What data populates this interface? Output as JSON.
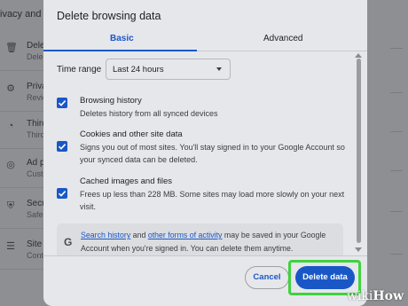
{
  "background": {
    "header_text": "ivacy and s",
    "rows": [
      {
        "icon": "trash-icon",
        "glyph": "🗑",
        "title": "Dele",
        "sub": "Dele"
      },
      {
        "icon": "privacy-guide-icon",
        "glyph": "⚙",
        "title": "Priva",
        "sub": "Revie"
      },
      {
        "icon": "cookie-icon",
        "glyph": "◔",
        "title": "Third",
        "sub": "Third"
      },
      {
        "icon": "ad-privacy-icon",
        "glyph": "◎",
        "title": "Ad p",
        "sub": "Custo"
      },
      {
        "icon": "security-icon",
        "glyph": "⛨",
        "title": "Secu",
        "sub": "Safe"
      },
      {
        "icon": "site-settings-icon",
        "glyph": "☰",
        "title": "Site s",
        "sub": "Contr"
      }
    ]
  },
  "dialog": {
    "title": "Delete browsing data",
    "tabs": [
      {
        "label": "Basic",
        "active": true
      },
      {
        "label": "Advanced",
        "active": false
      }
    ],
    "time_range": {
      "label": "Time range",
      "selected": "Last 24 hours"
    },
    "options": [
      {
        "title": "Browsing history",
        "desc": "Deletes history from all synced devices",
        "checked": true
      },
      {
        "title": "Cookies and other site data",
        "desc": "Signs you out of most sites. You'll stay signed in to your Google Account so your synced data can be deleted.",
        "checked": true
      },
      {
        "title": "Cached images and files",
        "desc": "Frees up less than 228 MB. Some sites may load more slowly on your next visit.",
        "checked": true
      }
    ],
    "info": {
      "icon_letter": "G",
      "link1": "Search history",
      "and": " and ",
      "link2": "other forms of activity",
      "rest": " may be saved in your Google Account when you're signed in. You can delete them anytime."
    },
    "buttons": {
      "cancel": "Cancel",
      "delete": "Delete data"
    },
    "accent_color": "#1a57c6",
    "highlight_color": "#3fd23f"
  },
  "watermark": {
    "part1": "wiki",
    "part2": "How"
  }
}
